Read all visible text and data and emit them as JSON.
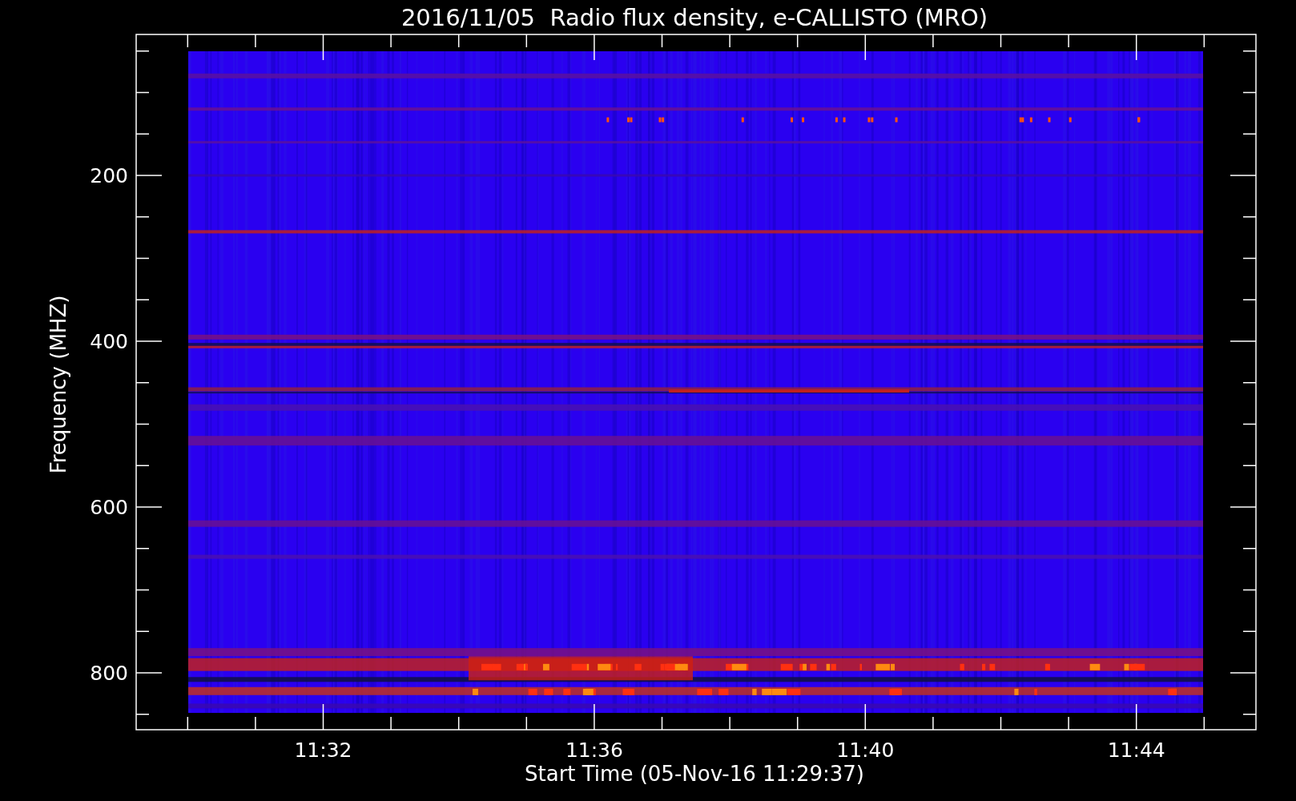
{
  "plot": {
    "title": "2016/11/05  Radio flux density, e-CALLISTO (MRO)",
    "xlabel": "Start Time (05-Nov-16 11:29:37)",
    "ylabel": "Frequency (MHZ)",
    "xticks": [
      "11:32",
      "11:36",
      "11:40",
      "11:44"
    ],
    "yticks": [
      "200",
      "400",
      "600",
      "800"
    ]
  }
}
